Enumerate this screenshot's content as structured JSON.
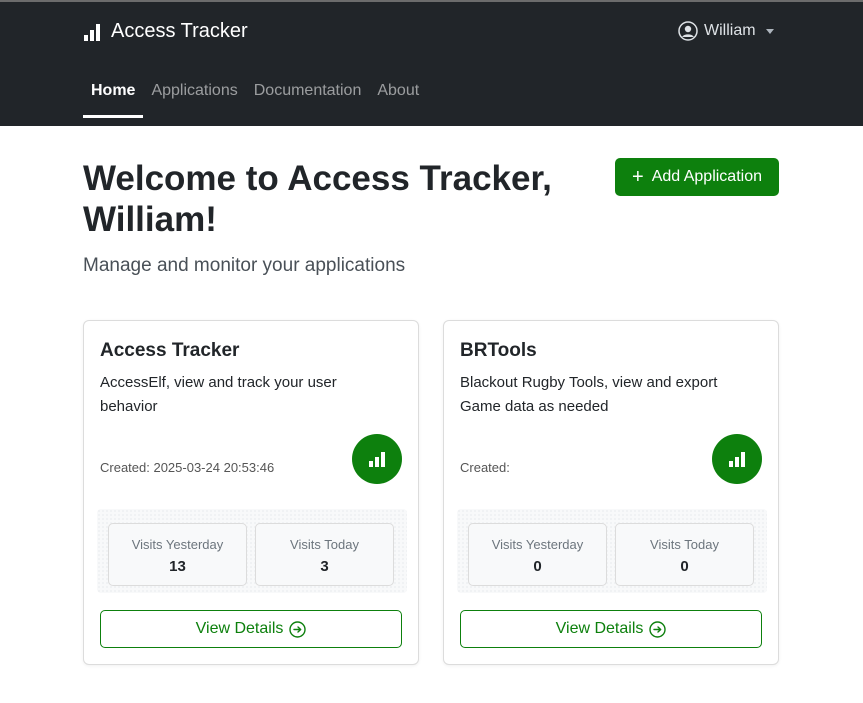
{
  "app": {
    "title": "Access Tracker"
  },
  "user": {
    "name": "William"
  },
  "nav": {
    "items": [
      "Home",
      "Applications",
      "Documentation",
      "About"
    ],
    "active": "Home"
  },
  "hero": {
    "title": "Welcome to Access Tracker, William!",
    "subtitle": "Manage and monitor your applications",
    "add_button": "Add Application"
  },
  "colors": {
    "accent": "#0d800d",
    "navbar": "#212529"
  },
  "cards": [
    {
      "title": "Access Tracker",
      "description": "AccessElf, view and track your user behavior",
      "created": "Created: 2025-03-24 20:53:46",
      "icon": "bar-chart-icon",
      "stats": [
        {
          "label": "Visits Yesterday",
          "value": "13"
        },
        {
          "label": "Visits Today",
          "value": "3"
        }
      ],
      "button": "View Details"
    },
    {
      "title": "BRTools",
      "description": "Blackout Rugby Tools, view and export Game data as needed",
      "created": "Created:",
      "icon": "bar-chart-icon",
      "stats": [
        {
          "label": "Visits Yesterday",
          "value": "0"
        },
        {
          "label": "Visits Today",
          "value": "0"
        }
      ],
      "button": "View Details"
    }
  ]
}
